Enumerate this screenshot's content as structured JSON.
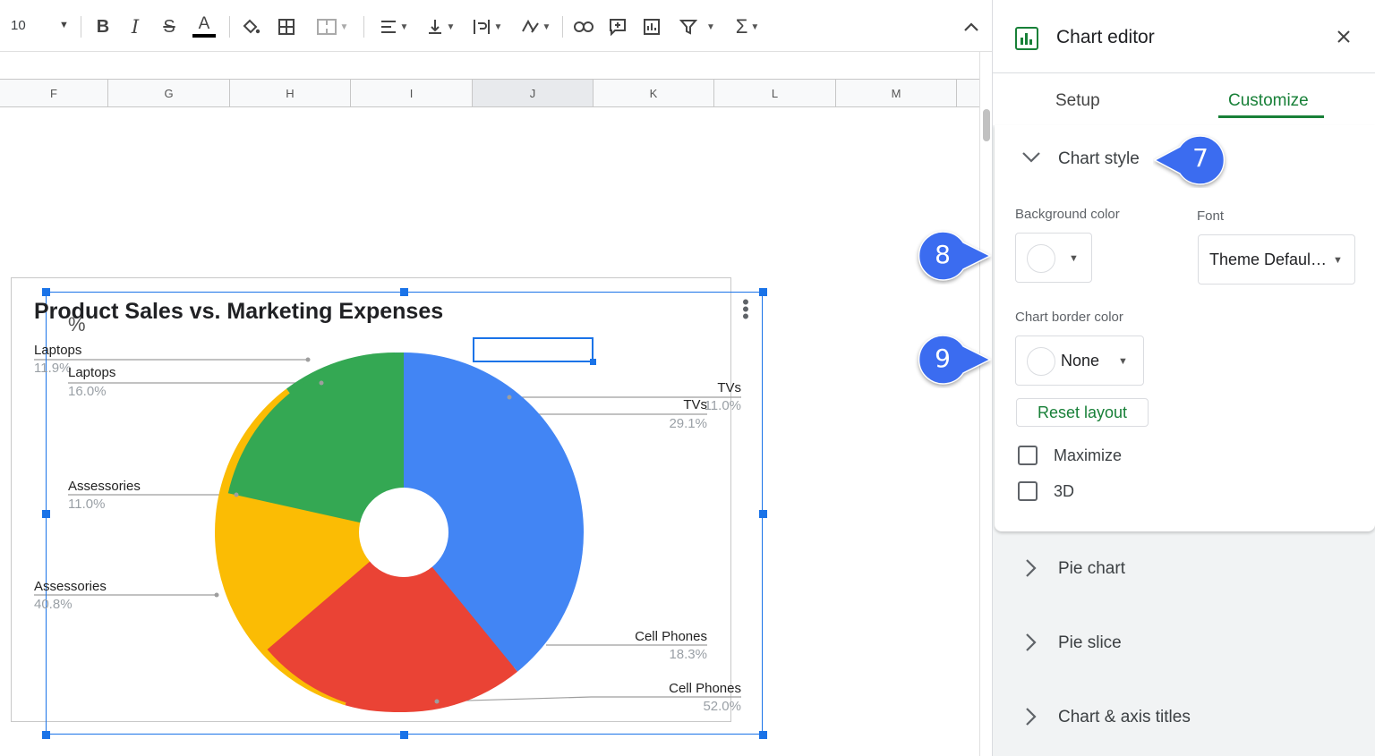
{
  "toolbar": {
    "font_size": "10",
    "bold_icon": "bold-icon",
    "italic_icon": "italic-icon",
    "strike_icon": "strikethrough-icon",
    "text_color_icon": "text-color-icon",
    "collapse_icon": "chevron-up-icon"
  },
  "columns": [
    "F",
    "G",
    "H",
    "I",
    "J",
    "K",
    "L",
    "M"
  ],
  "selected_column": "J",
  "chart": {
    "title": "Product Sales vs. Marketing Expenses",
    "percent_glyph": "%",
    "labels": {
      "laptops_outer_name": "Laptops",
      "laptops_outer_pct": "11.9%",
      "laptops_inner_name": "Laptops",
      "laptops_inner_pct": "16.0%",
      "tvs_outer_name": "TVs",
      "tvs_outer_pct": "11.0%",
      "tvs_inner_name": "TVs",
      "tvs_inner_pct": "29.1%",
      "acc_inner_name": "Assessories",
      "acc_inner_pct": "11.0%",
      "acc_outer_name": "Assessories",
      "acc_outer_pct": "40.8%",
      "cell_inner_name": "Cell Phones",
      "cell_inner_pct": "18.3%",
      "cell_outer_name": "Cell Phones",
      "cell_outer_pct": "52.0%"
    },
    "colors": {
      "tvs": "#4285f4",
      "cell_phones": "#ea4335",
      "assessories": "#fbbc04",
      "laptops": "#34a853"
    }
  },
  "chart_data": {
    "type": "pie",
    "title": "Product Sales vs. Marketing Expenses",
    "series": [
      {
        "name": "",
        "categories": [
          "TVs",
          "Cell Phones",
          "Assessories",
          "Laptops"
        ],
        "values": [
          29.1,
          18.3,
          11.0,
          16.0
        ]
      },
      {
        "name": "",
        "categories": [
          "TVs",
          "Cell Phones",
          "Assessories",
          "Laptops"
        ],
        "values": [
          11.0,
          52.0,
          40.8,
          11.9
        ]
      }
    ],
    "legend": "labeled",
    "donut_hole": true
  },
  "panel": {
    "title": "Chart editor",
    "close_icon": "close-icon",
    "tabs": [
      {
        "label": "Setup",
        "active": false
      },
      {
        "label": "Customize",
        "active": true
      }
    ],
    "section_chart_style": "Chart style",
    "background_color_label": "Background color",
    "font_label": "Font",
    "font_value": "Theme Defaul…",
    "border_color_label": "Chart border color",
    "border_color_value": "None",
    "reset_layout": "Reset layout",
    "maximize": "Maximize",
    "three_d": "3D",
    "sections": [
      "Pie chart",
      "Pie slice",
      "Chart & axis titles"
    ]
  },
  "callouts": [
    "7",
    "8",
    "9"
  ],
  "accent_color": "#188038",
  "callout_color": "#3b6cf0"
}
